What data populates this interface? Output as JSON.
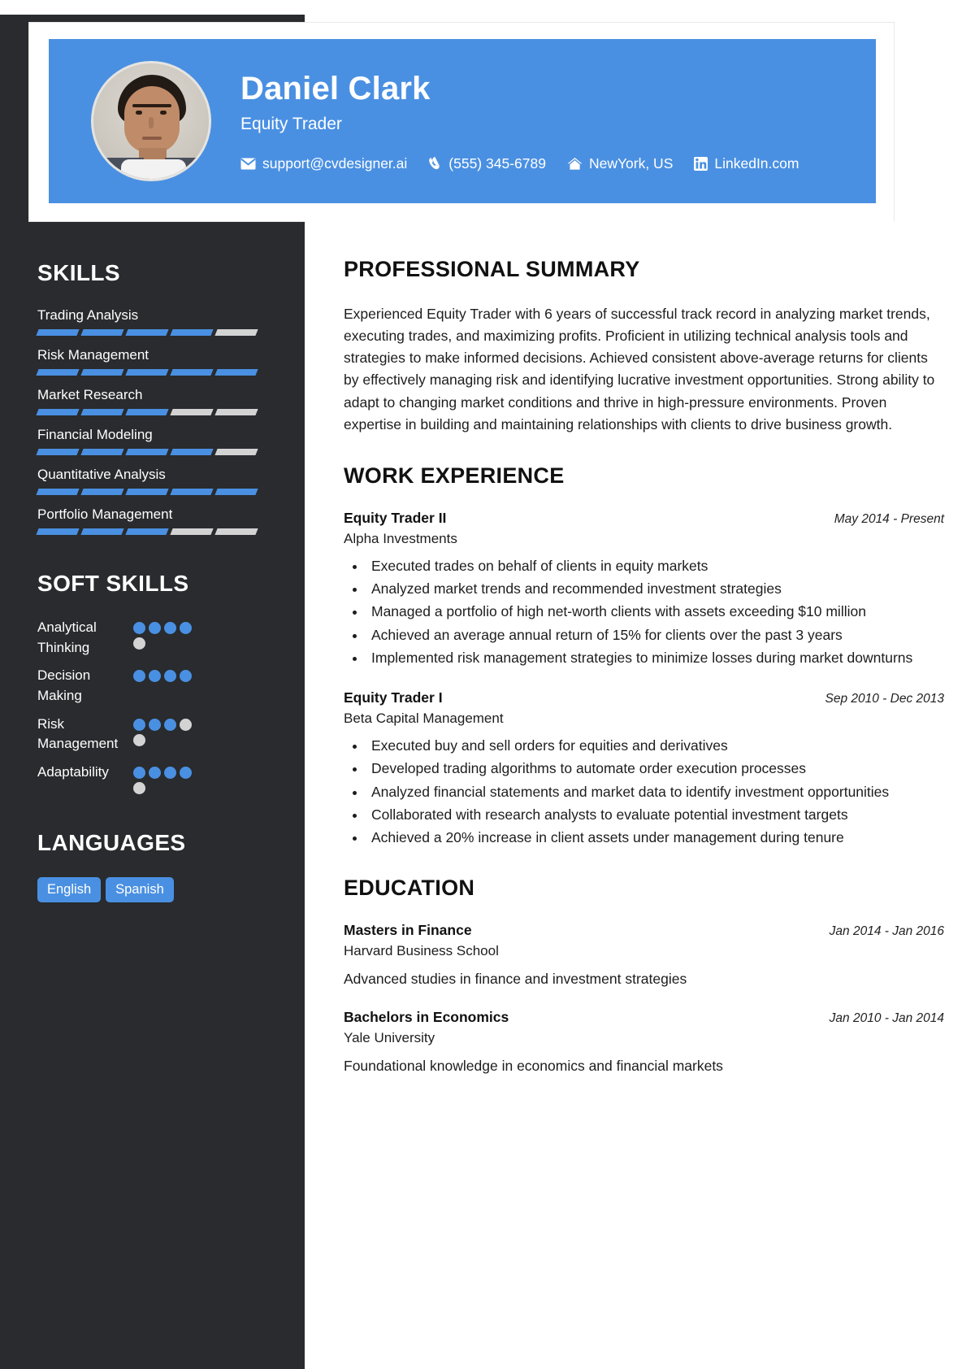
{
  "colors": {
    "accent": "#4a90e2",
    "sidebar_bg": "#292b2e",
    "bar_empty": "#d3d3d3"
  },
  "header": {
    "name": "Daniel Clark",
    "title": "Equity Trader",
    "contacts": [
      {
        "icon": "envelope-icon",
        "text": "support@cvdesigner.ai"
      },
      {
        "icon": "phone-icon",
        "text": "(555) 345-6789"
      },
      {
        "icon": "home-icon",
        "text": "NewYork, US"
      },
      {
        "icon": "linkedin-icon",
        "text": "LinkedIn.com"
      }
    ]
  },
  "sidebar": {
    "skills_heading": "SKILLS",
    "skills": [
      {
        "name": "Trading Analysis",
        "filled": 4,
        "total": 5
      },
      {
        "name": "Risk Management",
        "filled": 5,
        "total": 5
      },
      {
        "name": "Market Research",
        "filled": 3,
        "total": 5
      },
      {
        "name": "Financial Modeling",
        "filled": 4,
        "total": 5
      },
      {
        "name": "Quantitative Analysis",
        "filled": 5,
        "total": 5
      },
      {
        "name": "Portfolio Management",
        "filled": 3,
        "total": 5
      }
    ],
    "soft_heading": "SOFT SKILLS",
    "soft_skills": [
      {
        "name": "Analytical Thinking",
        "filled": 4,
        "total": 5
      },
      {
        "name": "Decision Making",
        "filled": 4,
        "total": 4
      },
      {
        "name": "Risk Management",
        "filled": 3,
        "total": 5
      },
      {
        "name": "Adaptability",
        "filled": 4,
        "total": 5
      }
    ],
    "languages_heading": "LANGUAGES",
    "languages": [
      "English",
      "Spanish"
    ]
  },
  "main": {
    "summary_heading": "PROFESSIONAL SUMMARY",
    "summary": "Experienced Equity Trader with 6 years of successful track record in analyzing market trends, executing trades, and maximizing profits. Proficient in utilizing technical analysis tools and strategies to make informed decisions. Achieved consistent above-average returns for clients by effectively managing risk and identifying lucrative investment opportunities. Strong ability to adapt to changing market conditions and thrive in high-pressure environments. Proven expertise in building and maintaining relationships with clients to drive business growth.",
    "work_heading": "WORK EXPERIENCE",
    "work": [
      {
        "role": "Equity Trader II",
        "dates": "May 2014 - Present",
        "org": "Alpha Investments",
        "bullets": [
          "Executed trades on behalf of clients in equity markets",
          "Analyzed market trends and recommended investment strategies",
          "Managed a portfolio of high net-worth clients with assets exceeding $10 million",
          "Achieved an average annual return of 15% for clients over the past 3 years",
          "Implemented risk management strategies to minimize losses during market downturns"
        ]
      },
      {
        "role": "Equity Trader I",
        "dates": "Sep 2010 - Dec 2013",
        "org": "Beta Capital Management",
        "bullets": [
          "Executed buy and sell orders for equities and derivatives",
          "Developed trading algorithms to automate order execution processes",
          "Analyzed financial statements and market data to identify investment opportunities",
          "Collaborated with research analysts to evaluate potential investment targets",
          "Achieved a 20% increase in client assets under management during tenure"
        ]
      }
    ],
    "education_heading": "EDUCATION",
    "education": [
      {
        "degree": "Masters in Finance",
        "dates": "Jan 2014 - Jan 2016",
        "school": "Harvard Business School",
        "description": "Advanced studies in finance and investment strategies"
      },
      {
        "degree": "Bachelors in Economics",
        "dates": "Jan 2010 - Jan 2014",
        "school": "Yale University",
        "description": "Foundational knowledge in economics and financial markets"
      }
    ]
  }
}
